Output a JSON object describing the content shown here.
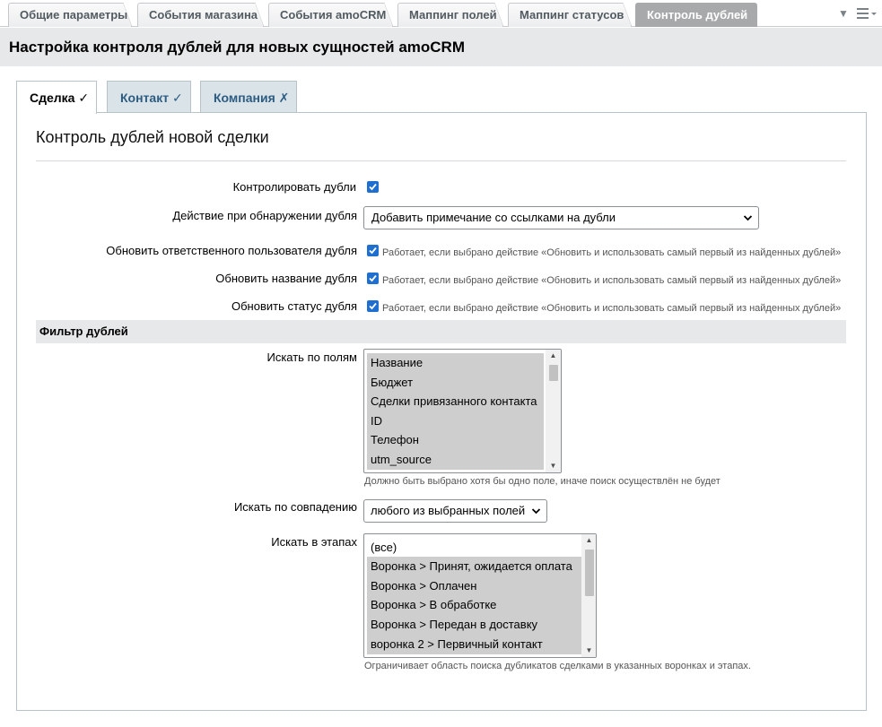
{
  "top_tabs": [
    {
      "label": "Общие параметры"
    },
    {
      "label": "События магазина"
    },
    {
      "label": "События amoCRM"
    },
    {
      "label": "Маппинг полей"
    },
    {
      "label": "Маппинг статусов"
    },
    {
      "label": "Контроль дублей",
      "active": true
    }
  ],
  "page": {
    "title": "Настройка контроля дублей для новых сущностей amoCRM"
  },
  "sub_tabs": [
    {
      "label": "Сделка ✓",
      "active": true
    },
    {
      "label": "Контакт ✓"
    },
    {
      "label": "Компания ✗"
    }
  ],
  "section": {
    "title": "Контроль дублей новой сделки"
  },
  "settings": {
    "control_label": "Контролировать дубли",
    "action_label": "Действие при обнаружении дубля",
    "action_value": "Добавить примечание со ссылками на дубли",
    "update_responsible_label": "Обновить ответственного пользователя дубля",
    "update_name_label": "Обновить название дубля",
    "update_status_label": "Обновить статус дубля",
    "hint": "Работает, если выбрано действие «Обновить и использовать самый первый из найденных дублей»"
  },
  "filter": {
    "title": "Фильтр дублей",
    "fields_label": "Искать по полям",
    "fields_options": [
      "Название",
      "Бюджет",
      "Сделки привязанного контакта",
      "ID",
      "Телефон",
      "utm_source"
    ],
    "fields_hint": "Должно быть выбрано хотя бы одно поле, иначе поиск осуществлён не будет",
    "match_label": "Искать по совпадению",
    "match_value": "любого из выбранных полей",
    "stages_label": "Искать в этапах",
    "stages_options": [
      "(все)",
      "Воронка > Принят, ожидается оплата",
      "Воронка > Оплачен",
      "Воронка > В обработке",
      "Воронка > Передан в доставку",
      "воронка 2 > Первичный контакт"
    ],
    "stages_hint": "Ограничивает область поиска дубликатов сделками в указанных воронках и этапах."
  },
  "icons": {
    "check": "checkmark-icon",
    "chevron": "chevron-down-icon",
    "menu": "hamburger-menu-icon"
  },
  "colors": {
    "checkbox": "#1f6fd1",
    "selected_option": "#cecece",
    "sub_tab_bg": "#dae4e8",
    "sub_tab_text": "#2c5c82",
    "active_top_tab": "#a7a9aa"
  }
}
